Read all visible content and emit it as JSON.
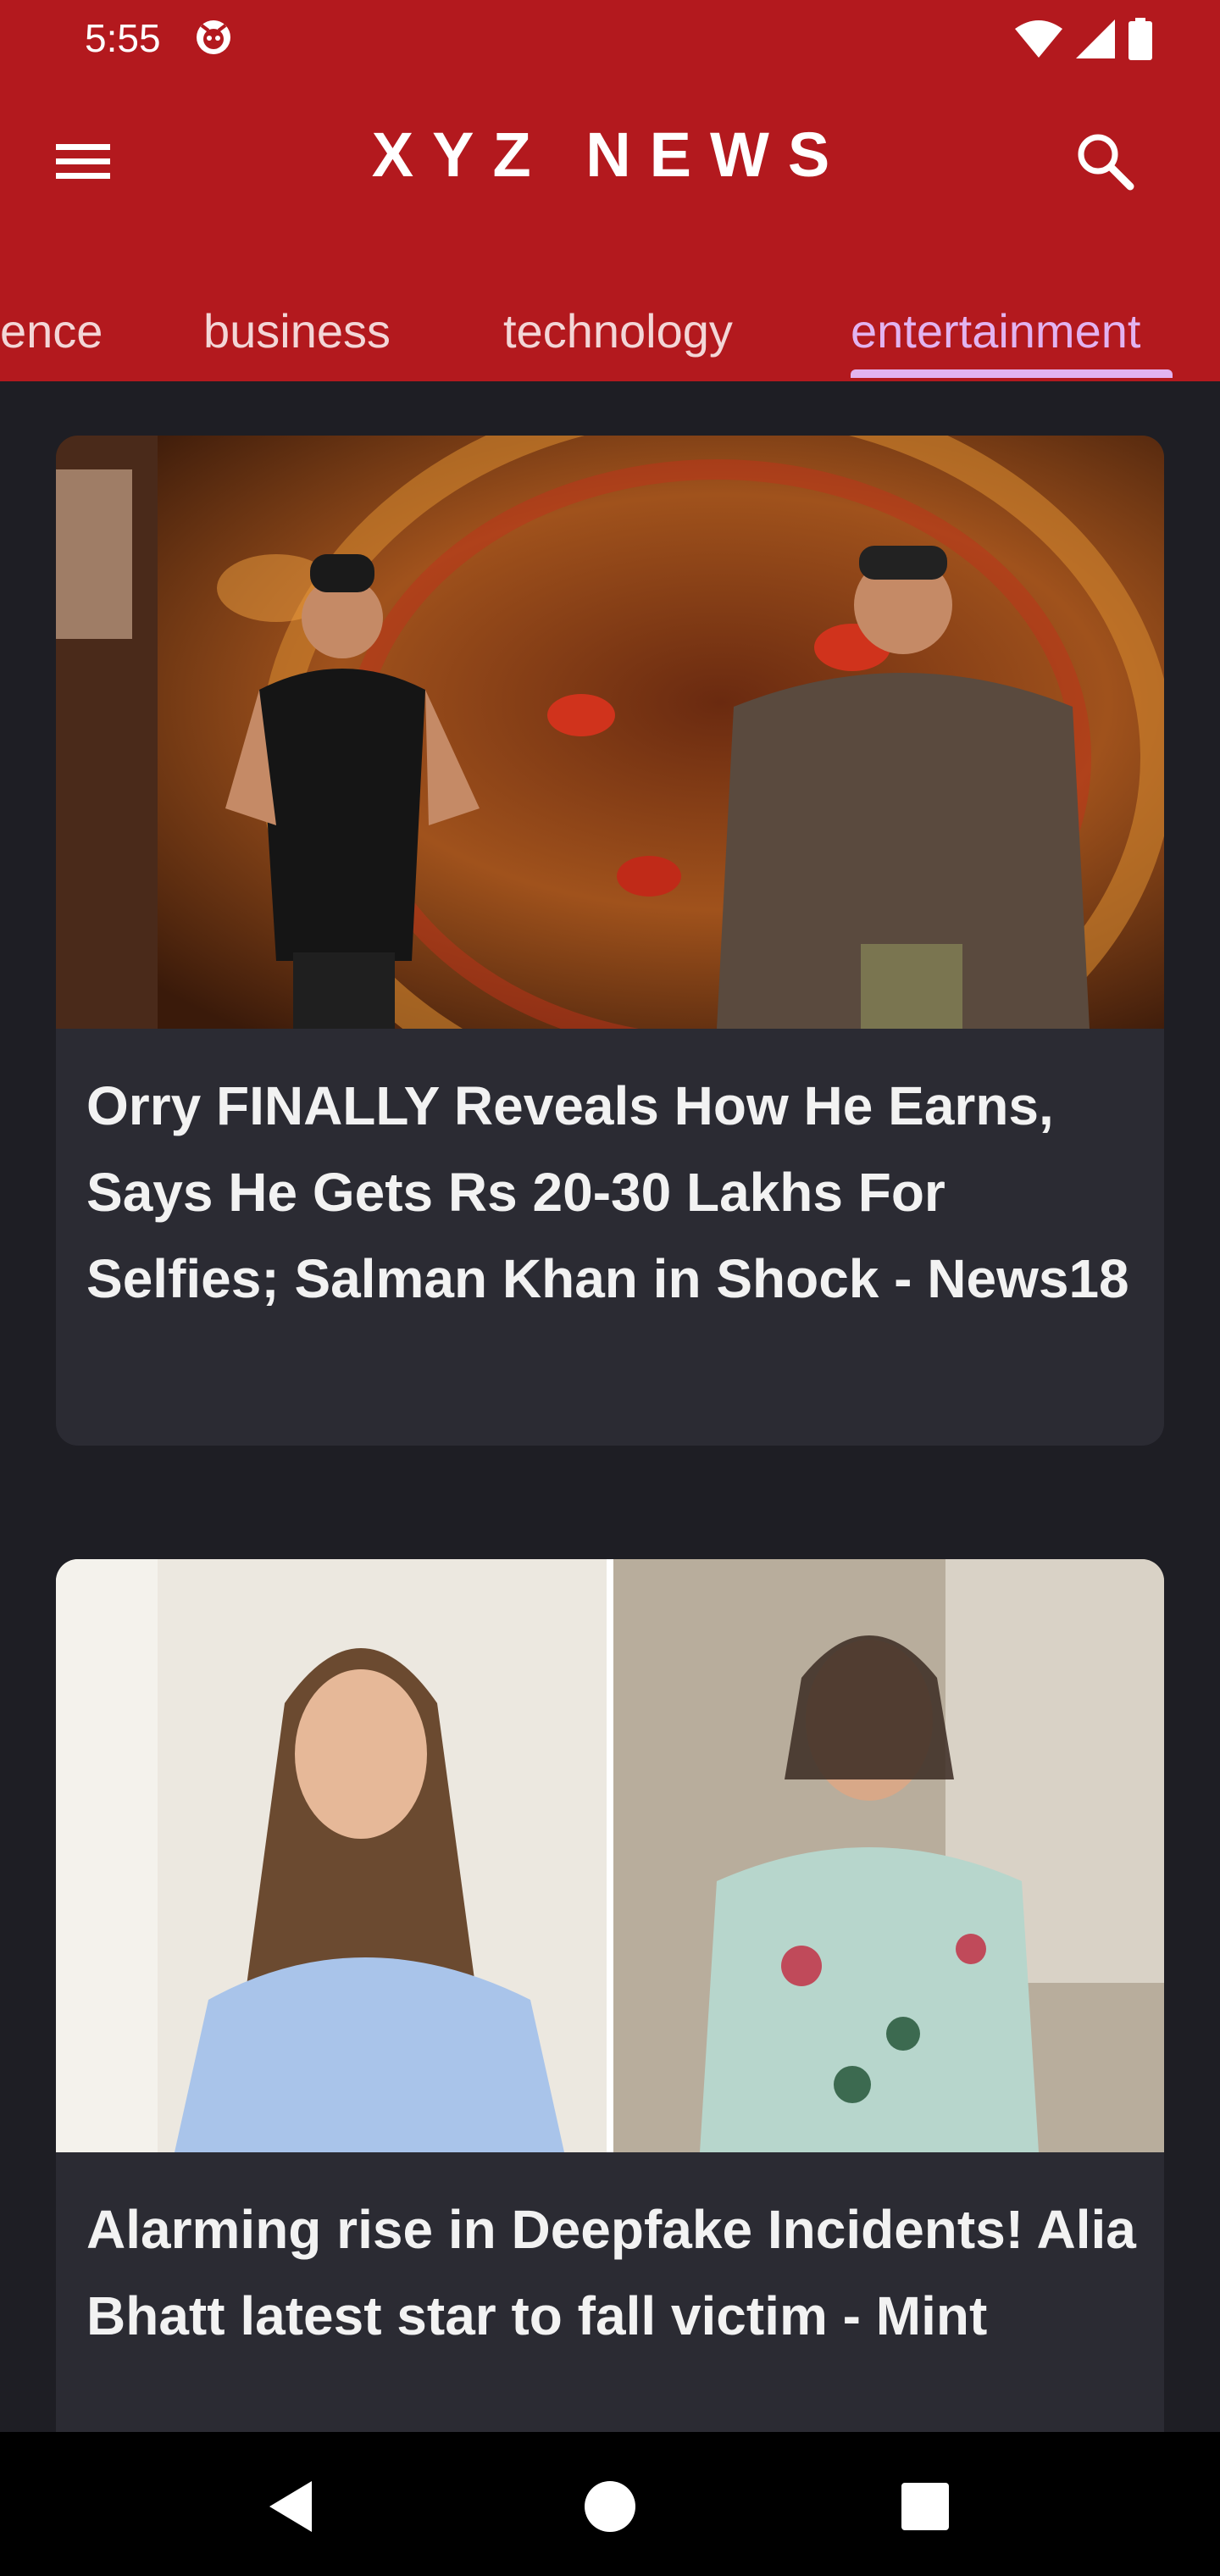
{
  "status_bar": {
    "time": "5:55",
    "icons": [
      "notification-icon",
      "wifi-icon",
      "signal-icon",
      "battery-icon"
    ]
  },
  "app_bar": {
    "title": "XYZ NEWS",
    "menu_icon": "menu-icon",
    "search_icon": "search-icon",
    "background": "#b3191e"
  },
  "tabs": [
    {
      "label": "ence",
      "active": false
    },
    {
      "label": "business",
      "active": false
    },
    {
      "label": "technology",
      "active": false
    },
    {
      "label": "entertainment",
      "active": true
    }
  ],
  "accent_color": "#e2b3f0",
  "articles": [
    {
      "title": "Orry FINALLY Reveals How He Earns, Says He Gets Rs 20-30 Lakhs For Selfies; Salman Khan in Shock - News18",
      "image": "two-men-on-stage-image"
    },
    {
      "title": "Alarming rise in Deepfake Incidents! Alia Bhatt latest star to fall victim - Mint",
      "image": "two-women-collage-image"
    }
  ],
  "nav_bar": {
    "icons": [
      "back-icon",
      "home-icon",
      "recents-icon"
    ]
  }
}
